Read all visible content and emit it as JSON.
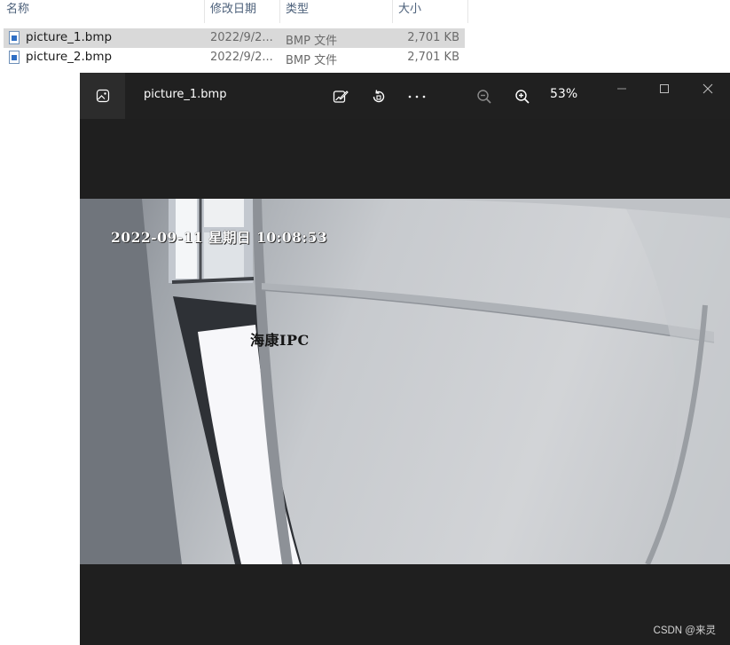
{
  "explorer": {
    "columns": {
      "name": "名称",
      "modified": "修改日期",
      "type": "类型",
      "size": "大小"
    },
    "files": [
      {
        "name": "picture_1.bmp",
        "modified": "2022/9/2...",
        "type": "BMP 文件",
        "size": "2,701 KB",
        "selected": true
      },
      {
        "name": "picture_2.bmp",
        "modified": "2022/9/2...",
        "type": "BMP 文件",
        "size": "2,701 KB",
        "selected": false
      }
    ]
  },
  "viewer": {
    "title": "picture_1.bmp",
    "zoom": "53%",
    "toolbar": [
      "edit-image-icon",
      "rotate-icon",
      "more-options-icon",
      "zoom-out-icon",
      "zoom-in-icon"
    ],
    "window_controls": [
      "minimize-icon",
      "maximize-icon",
      "close-icon"
    ]
  },
  "photo": {
    "timestamp": "2022-09-11 星期日 10:08:53",
    "camera_label": "海康IPC"
  },
  "watermark": "CSDN @来灵",
  "colors": {
    "viewer_bg": "#1f1f1f",
    "selected_row": "#d9d9d9",
    "column_header": "#4c607a"
  }
}
